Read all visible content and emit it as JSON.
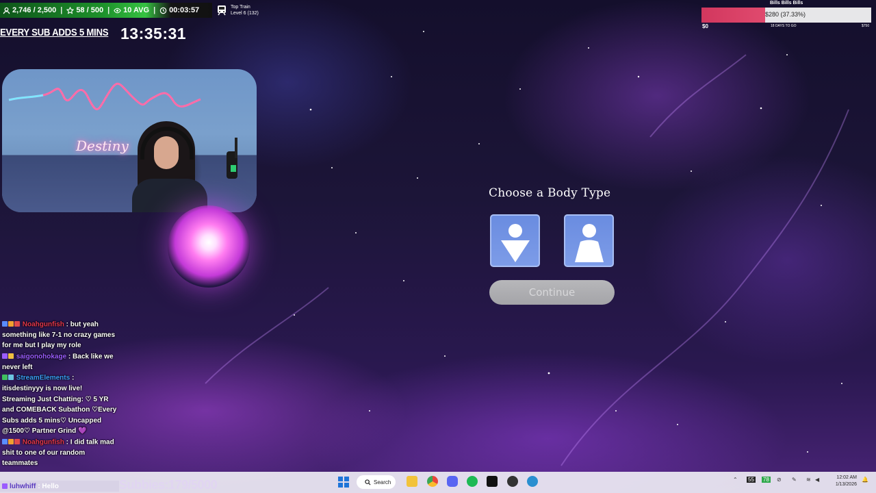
{
  "stats": {
    "followers": "2,746 / 2,500",
    "subs": "58 / 500",
    "viewers": "10 AVG",
    "elapsed": "00:03:57"
  },
  "train": {
    "label": "Top Train",
    "level": "Level 6 (132)"
  },
  "subathon": {
    "banner": "EVERY SUB ADDS 5 MINS",
    "timer": "13:35:31"
  },
  "goal": {
    "title": "Bills Bills Bills",
    "value_text": "$280 (37.33%)",
    "progress": 37.33,
    "low": "$0",
    "days": "18 DAYS TO GO",
    "high": "$750",
    "colors": {
      "fill": "#d2375e",
      "track": "#e7e7e9"
    }
  },
  "webcam": {
    "neon_text": "Destiny"
  },
  "game": {
    "title": "Choose a Body Type",
    "body_type_1": "body-type-a",
    "body_type_2": "body-type-b",
    "continue_label": "Continue"
  },
  "chat": {
    "messages": [
      {
        "user": "Noahgunfish",
        "text": ": but yeah something like 7-1 no crazy games for me but I play my role"
      },
      {
        "user": "saigonohokage",
        "text": ": Back like we never left"
      },
      {
        "user": "StreamElements",
        "text": ": itisdestinyyy is now live! Streaming Just Chatting: ♡ 5 YR and COMEBACK Subathon ♡Every Subs adds 5 mins♡ Uncapped @1500♡ Partner Grind"
      },
      {
        "user": "Noahgunfish",
        "text": ": I did talk mad shit to one of our random teammates"
      }
    ],
    "last": {
      "user": "luhwhiff",
      "text": ": Hello"
    }
  },
  "subbies": "Subbies:179/5000",
  "taskbar": {
    "search_label": "Search",
    "clock_time": "12:02 AM",
    "clock_date": "1/13/2026",
    "tray_badge": "55",
    "tray_badge2": "78"
  }
}
